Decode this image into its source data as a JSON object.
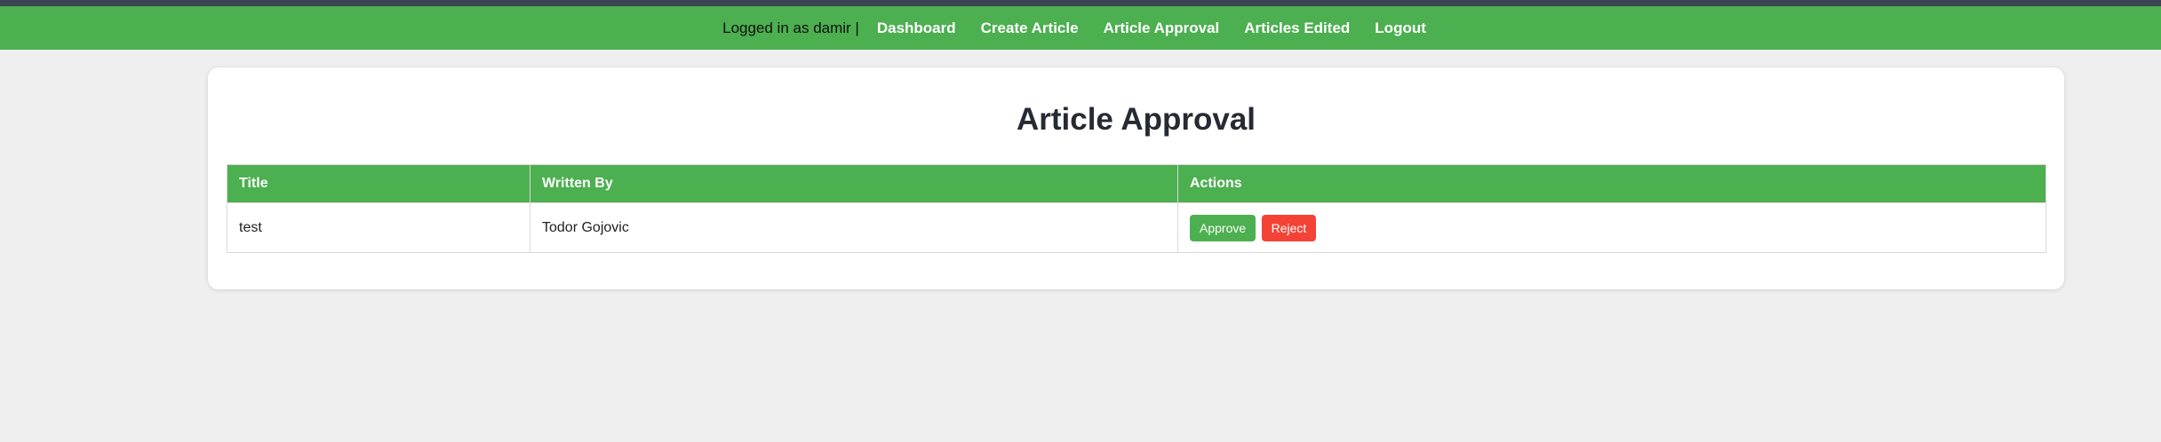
{
  "nav": {
    "user_text": "Logged in as damir |",
    "links": {
      "dashboard": "Dashboard",
      "create_article": "Create Article",
      "article_approval": "Article Approval",
      "articles_edited": "Articles Edited",
      "logout": "Logout"
    }
  },
  "main": {
    "title": "Article Approval",
    "table": {
      "headers": [
        "Title",
        "Written By",
        "Actions"
      ],
      "rows": [
        {
          "title": "test",
          "author": "Todor Gojovic",
          "approve_label": "Approve",
          "reject_label": "Reject"
        }
      ]
    }
  },
  "colors": {
    "brand_green": "#4caf50",
    "reject_red": "#f44336",
    "top_strip": "#3d4451",
    "page_bg": "#efefef"
  }
}
